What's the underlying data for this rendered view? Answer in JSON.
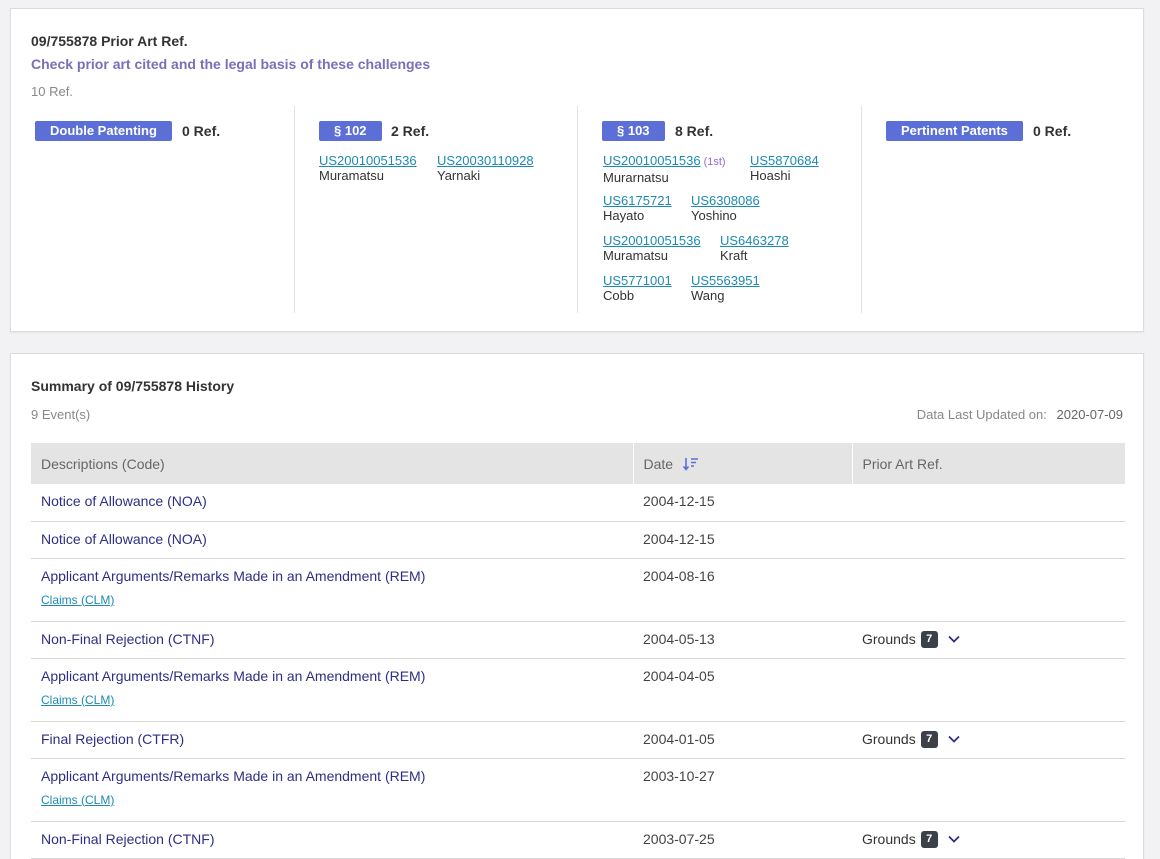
{
  "prior_art": {
    "title": "09/755878 Prior Art Ref.",
    "subtitle": "Check prior art cited and the legal basis of these challenges",
    "total": "10 Ref.",
    "groups": [
      {
        "badge": "Double Patenting",
        "count": "0 Ref.",
        "refs": []
      },
      {
        "badge": "§ 102",
        "count": "2 Ref.",
        "refs": [
          {
            "num": "US20010051536",
            "name": "Muramatsu"
          },
          {
            "num": "US20030110928",
            "name": "Yarnaki"
          }
        ]
      },
      {
        "badge": "§ 103",
        "count": "8 Ref.",
        "refs": [
          {
            "num": "US20010051536",
            "name": "Murarnatsu",
            "tag": "(1st)"
          },
          {
            "num": "US5870684",
            "name": "Hoashi"
          },
          {
            "num": "US6175721",
            "name": "Hayato"
          },
          {
            "num": "US6308086",
            "name": "Yoshino"
          },
          {
            "num": "US20010051536",
            "name": "Muramatsu"
          },
          {
            "num": "US6463278",
            "name": "Kraft"
          },
          {
            "num": "US5771001",
            "name": "Cobb"
          },
          {
            "num": "US5563951",
            "name": "Wang"
          }
        ]
      },
      {
        "badge": "Pertinent Patents",
        "count": "0 Ref.",
        "refs": []
      }
    ]
  },
  "history": {
    "title": "Summary of 09/755878 History",
    "events": "9 Event(s)",
    "updated_label": "Data Last Updated on:",
    "updated_value": "2020-07-09",
    "columns": [
      "Descriptions (Code)",
      "Date",
      "Prior Art Ref."
    ],
    "rows": [
      {
        "desc": "Notice of Allowance (NOA)",
        "date": "2004-12-15"
      },
      {
        "desc": "Notice of Allowance (NOA)",
        "date": "2004-12-15"
      },
      {
        "desc": "Applicant Arguments/Remarks Made in an Amendment (REM)",
        "sub": "Claims (CLM)",
        "date": "2004-08-16"
      },
      {
        "desc": "Non-Final Rejection (CTNF)",
        "date": "2004-05-13",
        "grounds": "Grounds",
        "grounds_count": "7"
      },
      {
        "desc": "Applicant Arguments/Remarks Made in an Amendment (REM)",
        "sub": "Claims (CLM)",
        "date": "2004-04-05"
      },
      {
        "desc": "Final Rejection (CTFR)",
        "date": "2004-01-05",
        "grounds": "Grounds",
        "grounds_count": "7"
      },
      {
        "desc": "Applicant Arguments/Remarks Made in an Amendment (REM)",
        "sub": "Claims (CLM)",
        "date": "2003-10-27"
      },
      {
        "desc": "Non-Final Rejection (CTNF)",
        "date": "2003-07-25",
        "grounds": "Grounds",
        "grounds_count": "7"
      }
    ]
  },
  "colors": {
    "accent": "#5c6fd6",
    "link": "#1c8ab4",
    "desc_link": "#2c2f84",
    "subtitle": "#7a6fb8"
  },
  "icons": {
    "sort": "sort-descending-icon",
    "expand": "chevron-down-icon"
  }
}
